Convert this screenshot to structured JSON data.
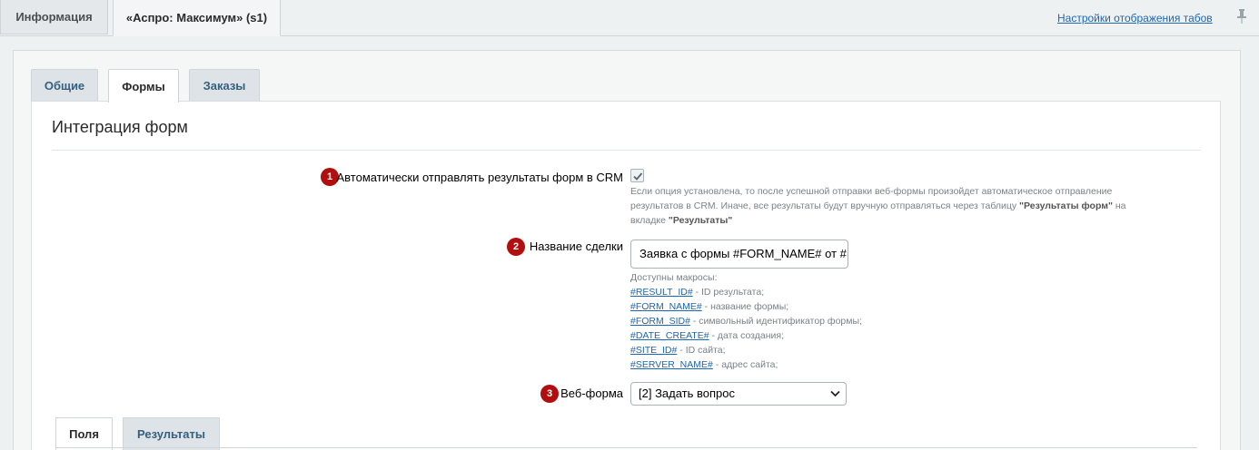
{
  "top_tabs": [
    {
      "label": "Информация"
    },
    {
      "label": "«Аспро: Максимум» (s1)"
    }
  ],
  "top_link": "Настройки отображения табов",
  "inner_tabs": [
    {
      "label": "Общие"
    },
    {
      "label": "Формы"
    },
    {
      "label": "Заказы"
    }
  ],
  "section_title": "Интеграция форм",
  "fields": {
    "auto_send": {
      "badge": "1",
      "label": "Автоматически отправлять результаты форм в CRM",
      "checked": true,
      "note_1": "Если опция установлена, то после успешной отправки веб-формы произойдет автоматическое отправление",
      "note_2a": "результатов в CRM. Иначе, все результаты будут вручную отправляться через таблицу ",
      "note_2b": "\"Результаты форм\"",
      "note_2c": " на",
      "note_3a": "вкладке ",
      "note_3b": "\"Результаты\""
    },
    "deal_name": {
      "badge": "2",
      "label": "Название сделки",
      "value": "Заявка с формы #FORM_NAME# от #",
      "macros_title": "Доступны макросы:",
      "macros": [
        {
          "code": "#RESULT_ID#",
          "desc": " - ID результата;"
        },
        {
          "code": "#FORM_NAME#",
          "desc": " - название формы;"
        },
        {
          "code": "#FORM_SID#",
          "desc": " - символьный идентификатор формы;"
        },
        {
          "code": "#DATE_CREATE#",
          "desc": " - дата создания;"
        },
        {
          "code": "#SITE_ID#",
          "desc": " - ID сайта;"
        },
        {
          "code": "#SERVER_NAME#",
          "desc": " - адрес сайта;"
        }
      ]
    },
    "web_form": {
      "badge": "3",
      "label": "Веб-форма",
      "selected": "[2] Задать вопрос"
    }
  },
  "bottom_tabs": [
    {
      "label": "Поля"
    },
    {
      "label": "Результаты"
    }
  ],
  "colors": {
    "accent_link": "#2067b0",
    "badge": "#b10f0f",
    "tab_inactive_text": "#35607e"
  }
}
